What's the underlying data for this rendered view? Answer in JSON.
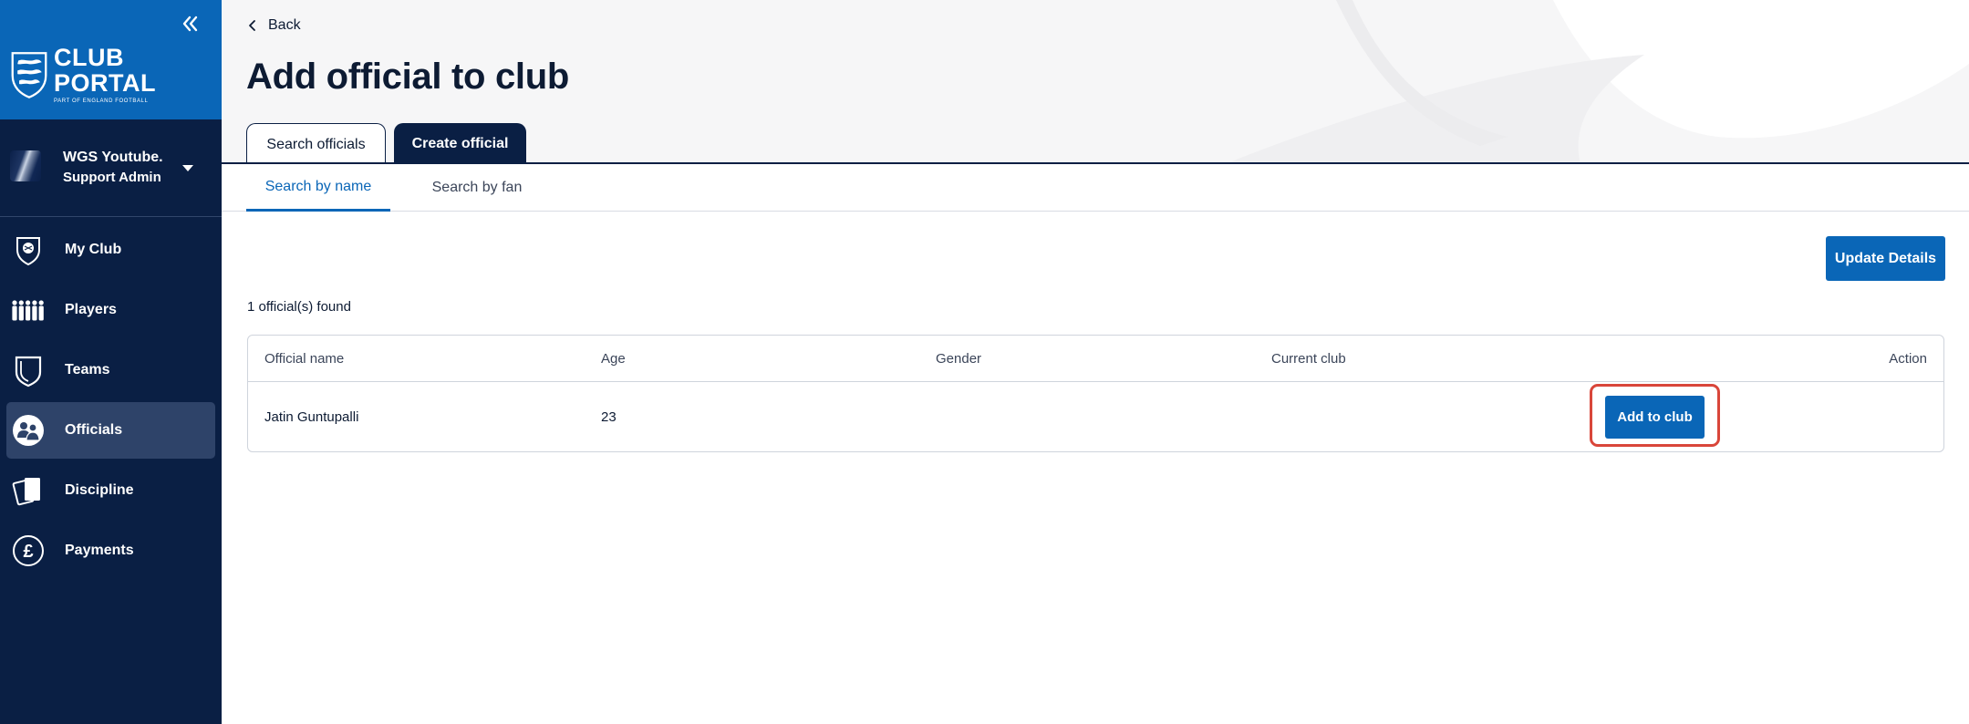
{
  "sidebar": {
    "logo": {
      "line1": "CLUB",
      "line2": "PORTAL",
      "sub": "PART OF ENGLAND FOOTBALL"
    },
    "account": {
      "name": "WGS Youtube...",
      "role": "Support Admin"
    },
    "items": [
      {
        "label": "My Club",
        "icon": "club-crest-icon"
      },
      {
        "label": "Players",
        "icon": "players-icon"
      },
      {
        "label": "Teams",
        "icon": "teams-shield-icon"
      },
      {
        "label": "Officials",
        "icon": "officials-icon",
        "active": true
      },
      {
        "label": "Discipline",
        "icon": "discipline-cards-icon"
      },
      {
        "label": "Payments",
        "icon": "pound-icon"
      }
    ]
  },
  "header": {
    "back_label": "Back",
    "title": "Add official to club",
    "tabs": [
      {
        "label": "Search officials",
        "active": true
      },
      {
        "label": "Create official",
        "active": false
      }
    ],
    "subtabs": [
      {
        "label": "Search by name",
        "active": true
      },
      {
        "label": "Search by fan",
        "active": false
      }
    ]
  },
  "main": {
    "update_label": "Update Details",
    "found_text": "1 official(s) found",
    "table": {
      "columns": [
        "Official name",
        "Age",
        "Gender",
        "Current club",
        "Action"
      ],
      "rows": [
        {
          "name": "Jatin Guntupalli",
          "age": "23",
          "gender": "",
          "club": "",
          "action_label": "Add to club"
        }
      ]
    }
  },
  "colors": {
    "brand_blue": "#0a66b7",
    "navy": "#0a1f44",
    "highlight": "#d9463a"
  }
}
